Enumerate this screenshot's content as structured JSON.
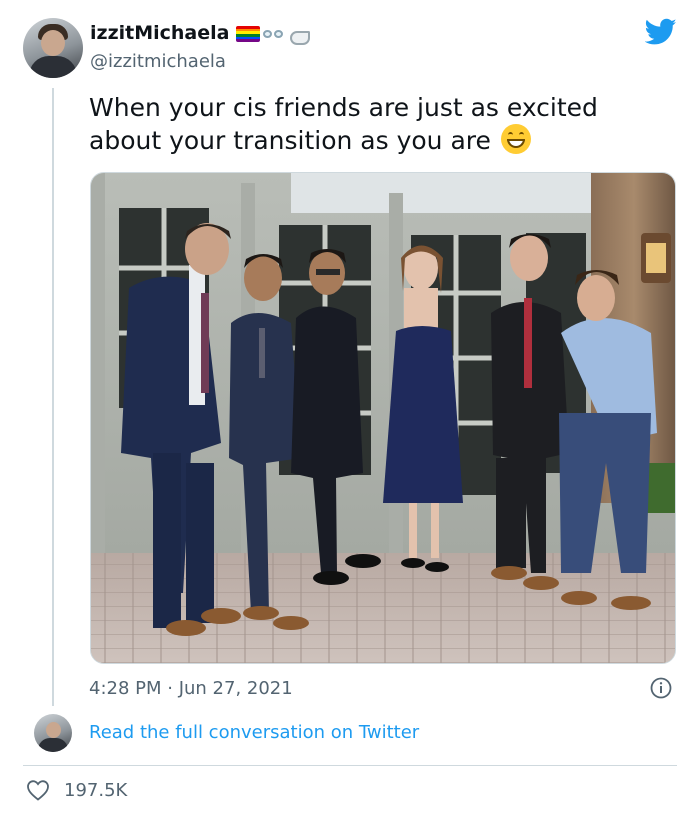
{
  "author": {
    "display_name": "izzitMichaela",
    "handle": "@izzitmichaela",
    "name_emojis": [
      "rainbow-flag-emoji",
      "goggles-emoji",
      "mechanical-arm-emoji"
    ]
  },
  "tweet": {
    "text": "When your cis friends are just as excited about your transition as you are",
    "trailing_emoji": "grinning-face-with-smiling-eyes",
    "timestamp": "4:28 PM · Jun 27, 2021"
  },
  "conversation_link": "Read the full conversation on Twitter",
  "likes": "197.5K",
  "colors": {
    "brand_blue": "#1d9bf0",
    "secondary_text": "#536471",
    "border": "#cfd9de",
    "rainbow": [
      "#e40303",
      "#ff8c00",
      "#ffed00",
      "#008026",
      "#004dff",
      "#750787"
    ]
  }
}
